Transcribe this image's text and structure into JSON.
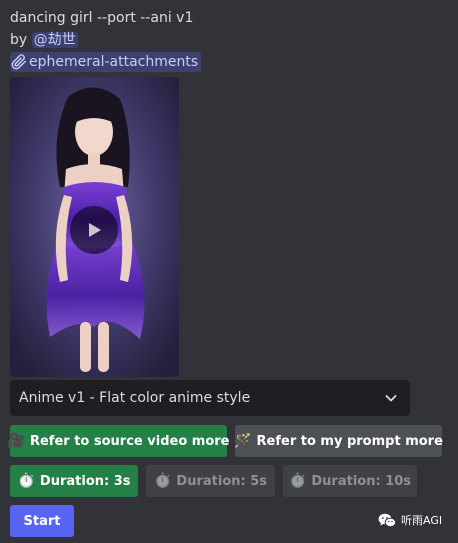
{
  "message": {
    "prompt_text": "dancing girl --port --ani v1",
    "by_prefix": "by",
    "mention": "@劫世",
    "attachment_channel": "ephemeral-attachments"
  },
  "video": {
    "icon": "play-icon"
  },
  "style_select": {
    "selected": "Anime v1 - Flat color anime style",
    "icon": "chevron-down-icon"
  },
  "buttons": {
    "refer_source": {
      "emoji": "🎥",
      "label": "Refer to source video more",
      "color": "#248046"
    },
    "refer_prompt": {
      "emoji": "🪄",
      "label": "Refer to my prompt more",
      "color": "#4e5058"
    },
    "duration_3s": {
      "emoji": "⏱️",
      "label": "Duration: 3s",
      "color": "#248046"
    },
    "duration_5s": {
      "emoji": "⏱️",
      "label": "Duration: 5s",
      "state": "disabled"
    },
    "duration_10s": {
      "emoji": "⏱️",
      "label": "Duration: 10s",
      "state": "disabled"
    },
    "start": {
      "label": "Start",
      "color": "#5865f2"
    }
  },
  "watermark": {
    "icon": "wechat-icon",
    "text": "听雨AGI"
  }
}
